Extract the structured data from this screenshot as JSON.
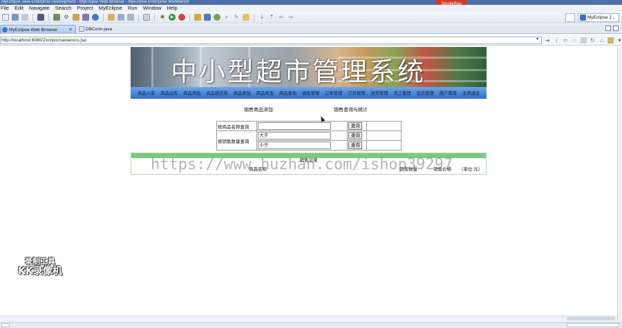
{
  "window": {
    "title": "MyEclipse Java Enterprise Development - MyEclipse Web Browser - MyEclipse Enterprise Workbench",
    "record_badge": "SimpleRep"
  },
  "menubar": {
    "items": [
      "File",
      "Edit",
      "Navigate",
      "Search",
      "Project",
      "MyEclipse",
      "Run",
      "Window",
      "Help"
    ]
  },
  "toolbar": {
    "perspective_label": "MyEclipse J..."
  },
  "tabs": [
    {
      "label": "MyEclipse Web Browser",
      "close": "✕"
    },
    {
      "label": "DBConn.java"
    }
  ],
  "address": {
    "url": "http://localhost:8080/Zxcnjxc/caxiaoxcu.jsp",
    "dropdown": "▾"
  },
  "page": {
    "banner_title": "中小型超市管理系统",
    "nav_items": [
      "商品入库",
      "商品出库",
      "商品添加",
      "商品供应商",
      "商品添加",
      "商品类型",
      "商品查询",
      "销售管理",
      "订单管理",
      "订货管理",
      "进货管理",
      "员工管理",
      "会员管理",
      "用户管理",
      "注销退出"
    ],
    "sub_tabs": {
      "left": "销售商品添加",
      "right": "销售查询与统计"
    },
    "query_form": {
      "by_name_label": "按商品名称查询",
      "by_qty_label": "按销售数量查询",
      "name_value": "",
      "greater_value": "大于",
      "less_value": "小于",
      "button_label": "查询"
    },
    "result": {
      "title": "销售记录",
      "col_name": "商品名称",
      "col_qty": "销售数量",
      "col_price": "销售价格",
      "col_unit": "（单位:元）"
    }
  },
  "overlay": {
    "watermark": "https://www.huzhan.com/ishop39297",
    "rec_logo_line1": "录制工具",
    "rec_logo_line2": "KK录像机"
  }
}
